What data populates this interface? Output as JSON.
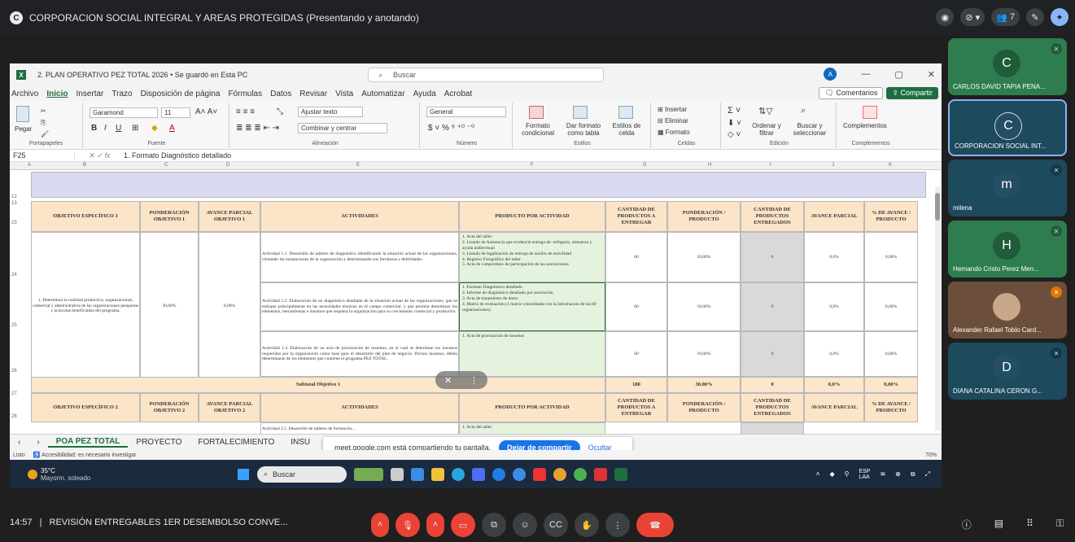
{
  "meet": {
    "title": "CORPORACION SOCIAL INTEGRAL Y AREAS PROTEGIDAS (Presentando y anotando)",
    "logo_letter": "C",
    "participant_count": "7",
    "clock": "14:57",
    "meeting_name": "REVISIÓN ENTREGABLES 1ER DESEMBOLSO CONVE...",
    "separator": "|"
  },
  "participants": [
    {
      "initial": "C",
      "name": "CARLOS DAVID TAPIA PENA...",
      "color": "#2e7d4f"
    },
    {
      "initial": "C",
      "name": "CORPORACION SOCIAL INT...",
      "color": "#2a6a8a"
    },
    {
      "initial": "m",
      "name": "milena",
      "color": "#2a6a8a"
    },
    {
      "initial": "H",
      "name": "Hernando Cristo Perez Men...",
      "color": "#2e7d4f"
    },
    {
      "initial": "",
      "name": "Alexander Rafael Tobio Card...",
      "color": "#8a6a4a"
    },
    {
      "initial": "D",
      "name": "DIANA CATALINA CERON G...",
      "color": "#2a6a8a"
    }
  ],
  "excel": {
    "title": "2. PLAN OPERATIVO PEZ TOTAL 2026 • Se guardó en Esta PC",
    "search_placeholder": "Buscar",
    "avatar_letter": "A",
    "menu": [
      "Archivo",
      "Inicio",
      "Insertar",
      "Trazo",
      "Disposición de página",
      "Fórmulas",
      "Datos",
      "Revisar",
      "Vista",
      "Automatizar",
      "Ayuda",
      "Acrobat"
    ],
    "comments_label": "Comentarios",
    "share_label": "Compartir",
    "ribbon": {
      "paste": "Pegar",
      "clipboard": "Portapapeles",
      "font_name": "Garamond",
      "font_size": "11",
      "font_group": "Fuente",
      "wrap": "Ajustar texto",
      "merge": "Combinar y centrar",
      "align_group": "Alineación",
      "number_format": "General",
      "number_group": "Número",
      "cond_format": "Formato condicional",
      "table_format": "Dar formato como tabla",
      "cell_styles": "Estilos de celda",
      "styles_group": "Estilos",
      "insert": "Insertar",
      "delete": "Eliminar",
      "format": "Formato",
      "cells_group": "Celdas",
      "sort": "Ordenar y filtrar",
      "find": "Buscar y seleccionar",
      "edit_group": "Edición",
      "addins": "Complementos",
      "addins_group": "Complementos"
    },
    "cell_ref": "F25",
    "formula": "1. Formato Diagnóstico detallado",
    "columns": [
      "A",
      "B",
      "C",
      "D",
      "E",
      "F",
      "G",
      "H",
      "I",
      "J",
      "K"
    ],
    "rows": [
      "12",
      "13",
      "23",
      "24",
      "25",
      "26",
      "27",
      "28"
    ],
    "headers1": {
      "obj": "OBJETIVO ESPECÍFICO 1",
      "pond": "PONDERACIÓN OBJETIVO 1",
      "avance": "AVANCE PARCIAL OBJETIVO 1",
      "act": "ACTIVIDADES",
      "prod": "PRODUCTO POR ACTIVIDAD",
      "cant": "CANTIDAD DE PRODUCTOS A ENTREGAR",
      "pondp": "PONDERACIÓN / PRODUCTO",
      "cante": "CANTIDAD DE PRODUCTOS ENTREGADOS",
      "avp": "AVANCE PARCIAL",
      "pct": "% DE AVANCE / PRODUCTO"
    },
    "objective1": "1. Determinar la realidad productiva, organizacional, comercial y administrativa de las organizaciones pesqueras y acuícolas beneficiadas del programa.",
    "pond1": "30,00%",
    "avance1": "0,00%",
    "activities": [
      {
        "text": "Actividad 1.1. Desarrollo de talleres de diagnóstico identificando la situación actual de las organizaciones, visitando las instalaciones de la organización y determinando sus fortalezas y debilidades.",
        "product": "1. Acta del taller\n2. Listado de Asistencia que evidencie entrega de: refrigerio, almuerzo y ayuda audiovisual\n3. Listado de legalización de entrega de auxilio de movilidad\n4. Registro Fotográfico del taller\n5. Acta de compromiso de participación de las asociaciones",
        "cant": "60",
        "pond": "10,00%",
        "ent": "0",
        "avp": "0,0%",
        "pct": "0,00%"
      },
      {
        "text": "Actividad 1.2. Elaboración de un diagnóstico detallado de la situación actual de las organizaciones, que se enfoque principalmente en las necesidades técnicas en el campo comercial, y que permita determinar los elementos, herramientas e insumos que requiera la organización para su crecimiento comercial y productivo.",
        "product": "1. Formato Diagnóstico detallado\n2. Informe de diagnóstico detallado por asociación.\n3. Acta de tratamiento de datos.\n4. Matriz de evaluación (1 matriz consolidada con la información de las 60 organizaciones)",
        "cant": "60",
        "pond": "10,00%",
        "ent": "0",
        "avp": "0,0%",
        "pct": "0,00%"
      },
      {
        "text": "Actividad 1.3. Elaboración de un acta de priorización de insumos, en el cual se determine los insumos requeridos por la organización como base para el desarrollo del plan de negocio. Dichos insumos, deben determinarse de los elementos que contiene el programa PEZ TOTAL.",
        "product": "1. Acta de priorización de insumos",
        "cant": "60",
        "pond": "10,00%",
        "ent": "0",
        "avp": "0,0%",
        "pct": "0,00%"
      }
    ],
    "subtotal": {
      "label": "Subtotal Objetivo 1",
      "cant": "180",
      "pond": "30,00%",
      "ent": "0",
      "avp": "0,0%",
      "pct": "0,00%"
    },
    "headers2": {
      "obj": "OBJETIVO ESPECÍFICO 2",
      "pond": "PONDERACIÓN OBJETIVO 2",
      "avance": "AVANCE PARCIAL OBJETIVO 2",
      "act": "ACTIVIDADES",
      "prod": "PRODUCTO POR ACTIVIDAD",
      "cant": "CANTIDAD DE PRODUCTOS A ENTREGAR",
      "pondp": "PONDERACIÓN / PRODUCTO",
      "cante": "CANTIDAD DE PRODUCTOS ENTREGADOS",
      "avp": "AVANCE PARCIAL",
      "pct": "% DE AVANCE / PRODUCTO"
    },
    "row28_act": "Actividad 2.1. Desarrollo de talleres de formación...",
    "row28_prod": "1. Acta del taller",
    "sheets": [
      "POA PEZ TOTAL",
      "PROYECTO",
      "FORTALECIMIENTO",
      "INSU"
    ],
    "status_ready": "Listo",
    "status_access": "Accesibilidad: es necesario investigar",
    "zoom": "70%"
  },
  "share_bar": {
    "message": "meet.google.com está compartiendo tu pantalla.",
    "stop": "Dejar de compartir",
    "hide": "Ocultar"
  },
  "taskbar": {
    "temp": "35°C",
    "weather": "Mayorm. soleado",
    "search": "Buscar",
    "lang": "ESP",
    "lang2": "LAA"
  }
}
